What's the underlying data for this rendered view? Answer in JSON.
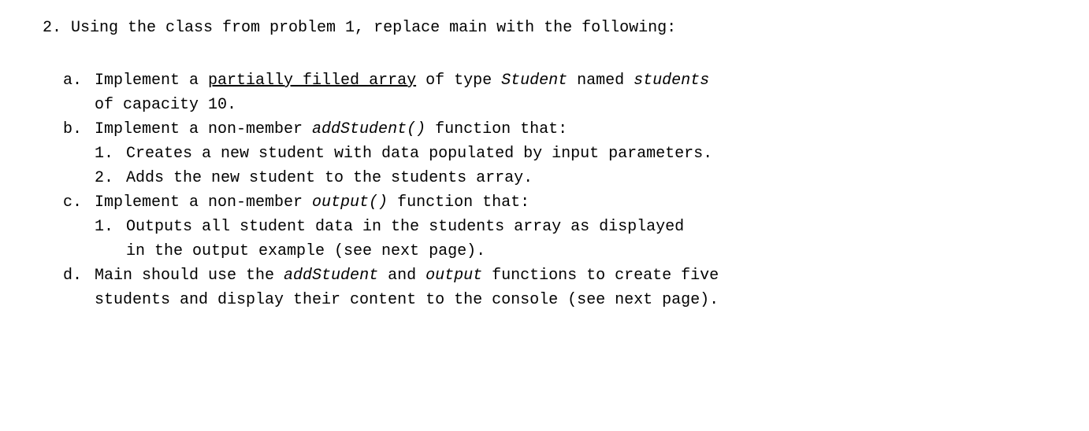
{
  "problem": {
    "marker": "2.",
    "text": "Using the class from problem 1, replace main with the following:"
  },
  "items": {
    "a": {
      "marker": "a.",
      "pre": "Implement a ",
      "underlined": "partially filled array",
      "mid": " of type ",
      "italic1": "Student",
      "mid2": " named ",
      "italic2": "students",
      "line2": "of capacity 10."
    },
    "b": {
      "marker": "b.",
      "pre": "Implement a non-member ",
      "italic1": "addStudent()",
      "post": " function that:",
      "n1_marker": "1.",
      "n1_text": "Creates a new student with data populated by input parameters.",
      "n2_marker": "2.",
      "n2_text": "Adds the new student to the students array."
    },
    "c": {
      "marker": "c.",
      "pre": "Implement a non-member ",
      "italic1": "output()",
      "post": " function that:",
      "n1_marker": "1.",
      "n1_line1": "Outputs all student data in the students array as displayed",
      "n1_line2": "in the output example (see next page)."
    },
    "d": {
      "marker": "d.",
      "pre": "Main should use the ",
      "italic1": "addStudent",
      "mid1": " and ",
      "italic2": "output",
      "post": " functions to create five",
      "line2": "students and display their content to the console (see next page)."
    }
  }
}
